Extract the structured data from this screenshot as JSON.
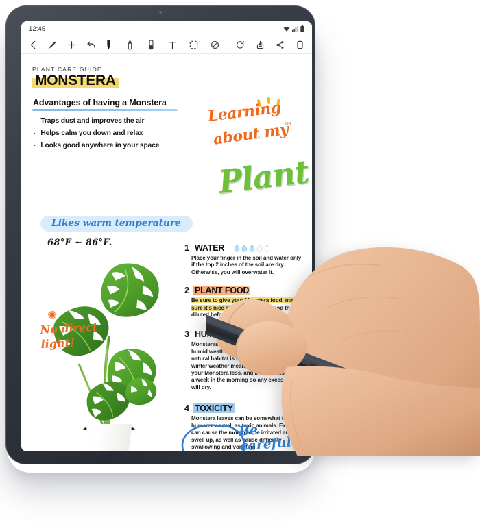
{
  "device": {
    "type": "tablet",
    "status_bar": {
      "clock": "12:45",
      "icons": [
        "wifi-icon",
        "signal-icon",
        "battery-icon"
      ]
    },
    "toolbar": {
      "left": [
        {
          "name": "back-button",
          "icon": "arrow-left-icon",
          "label": "Back"
        },
        {
          "name": "pen-settings-button",
          "icon": "pen-icon",
          "label": "Pen"
        },
        {
          "name": "add-page-button",
          "icon": "plus-icon",
          "label": "Add"
        },
        {
          "name": "undo-button",
          "icon": "undo-arrow-icon",
          "label": "Undo"
        }
      ],
      "center": [
        {
          "name": "tool-pen",
          "icon": "pen-tip-icon",
          "label": "Pen",
          "selected": true
        },
        {
          "name": "tool-highlighter",
          "icon": "highlighter-icon",
          "label": "Highlighter"
        },
        {
          "name": "tool-eraser",
          "icon": "eraser-icon",
          "label": "Eraser"
        },
        {
          "name": "tool-text",
          "icon": "text-icon",
          "label": "Text"
        },
        {
          "name": "tool-select",
          "icon": "lasso-select-icon",
          "label": "Selection"
        },
        {
          "name": "tool-palm-reject",
          "icon": "no-touch-icon",
          "label": "Palm rejection"
        }
      ],
      "right": [
        {
          "name": "redo-button",
          "icon": "circular-arrow-icon",
          "label": "Redo"
        },
        {
          "name": "save-button",
          "icon": "save-icon",
          "label": "Save"
        },
        {
          "name": "share-button",
          "icon": "share-icon",
          "label": "Share"
        },
        {
          "name": "more-button",
          "icon": "copy-icon",
          "label": "More"
        }
      ]
    }
  },
  "note": {
    "page_number": "05",
    "kicker": "PLANT CARE GUIDE",
    "title": "MONSTERA",
    "subtitle": "Advantages of having a Monstera",
    "bullets": [
      "Traps dust and improves the air",
      "Helps calm you down and relax",
      "Looks good anywhere in your space"
    ],
    "handwriting": {
      "line1": "Learning",
      "line2": "about my",
      "line3": "Plant",
      "temperature_pill": "Likes warm temperature",
      "temperature_value": "68°F ~ 86°F.",
      "no_light_line1": "No direct",
      "no_light_line2": "light!",
      "be_careful": "Be careful"
    },
    "sections": [
      {
        "number": "1",
        "title": "WATER",
        "highlight": "none",
        "drops_filled": 3,
        "drops_total": 5,
        "body": "Place your finger in the soil and water only if the top 2 inches of the soil are dry. Otherwise, you will overwater it."
      },
      {
        "number": "2",
        "title": "PLANT FOOD",
        "highlight": "orange",
        "body_highlighted": "Be sure to give your Monstera food, make sure it's nice and healthy",
        "body": "plant food that is diluted before giving."
      },
      {
        "number": "3",
        "title": "HUMIDITY",
        "highlight": "none",
        "body": "Monsteras can thrive in a range of hot and humid weather as a tropical plant. Its natural habitat is rainforest. But dry or winter weather means you should water your Monstera less, and instead mist twice a week in the morning so any excess water will dry."
      },
      {
        "number": "4",
        "title": "TOXICITY",
        "highlight": "blue",
        "body": "Monstera leaves can be somewhat toxic to humans, as well as toxic animals. Exposure can cause the mouth to be irritated and swell up, as well as cause difficulty swallowing and vomiting."
      }
    ]
  },
  "colors": {
    "orange_ink": "#ef6a20",
    "green_ink": "#6ec03a",
    "blue_ink": "#2e7fd4",
    "yellow_highlight": "#f5d96b",
    "blue_highlight": "#9fcdf2",
    "orange_highlight": "#f7a36a",
    "device_body": "#2f343d"
  },
  "stylus": {
    "name": "stylus-pen",
    "color": "#2b2f36"
  }
}
